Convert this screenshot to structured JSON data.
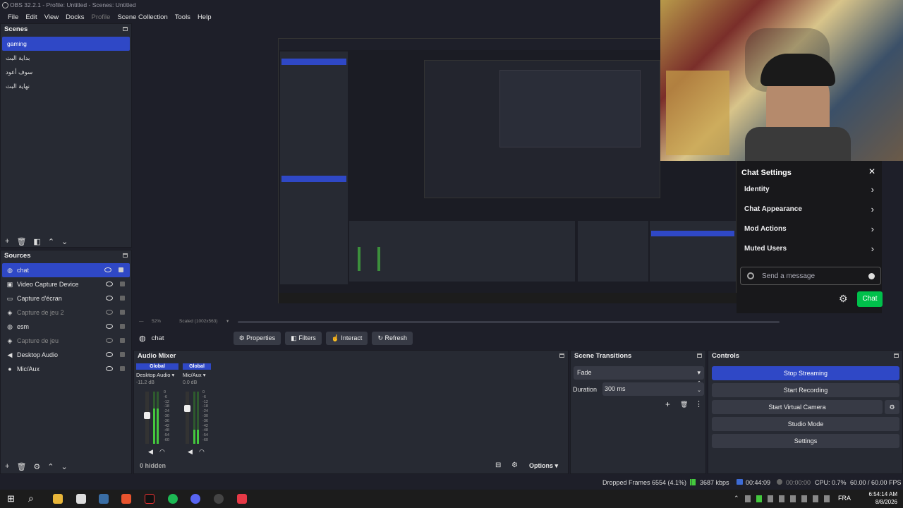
{
  "window": {
    "title": "OBS 32.2.1 - Profile: Untitled - Scenes: Untitled"
  },
  "menu": [
    "File",
    "Edit",
    "View",
    "Docks",
    "Profile",
    "Scene Collection",
    "Tools",
    "Help"
  ],
  "scenes": {
    "title": "Scenes",
    "items": [
      {
        "label": "gaming",
        "selected": true
      },
      {
        "label": "بداية البث",
        "selected": false
      },
      {
        "label": "سوف أعود",
        "selected": false
      },
      {
        "label": "نهاية البث",
        "selected": false
      }
    ]
  },
  "sources": {
    "title": "Sources",
    "items": [
      {
        "label": "chat",
        "icon": "globe-icon",
        "selected": true,
        "visible": true,
        "locked": true
      },
      {
        "label": "Video Capture Device",
        "icon": "camera-icon",
        "selected": false,
        "visible": true,
        "locked": false
      },
      {
        "label": "Capture d'écran",
        "icon": "monitor-icon",
        "selected": false,
        "visible": true,
        "locked": false
      },
      {
        "label": "Capture de jeu 2",
        "icon": "gamepad-icon",
        "selected": false,
        "visible": false,
        "locked": false
      },
      {
        "label": "esm",
        "icon": "globe-icon",
        "selected": false,
        "visible": true,
        "locked": false
      },
      {
        "label": "Capture de jeu",
        "icon": "gamepad-icon",
        "selected": false,
        "visible": false,
        "locked": false
      },
      {
        "label": "Desktop Audio",
        "icon": "speaker-icon",
        "selected": false,
        "visible": true,
        "locked": false
      },
      {
        "label": "Mic/Aux",
        "icon": "mic-icon",
        "selected": false,
        "visible": true,
        "locked": false
      }
    ]
  },
  "preview": {
    "zoom": "52%",
    "scaled": "Scaled (1002x563)"
  },
  "chat_settings": {
    "title": "Chat Settings",
    "items": [
      "Identity",
      "Chat Appearance",
      "Mod Actions",
      "Muted Users"
    ],
    "placeholder": "Send a message",
    "chat_button": "Chat"
  },
  "source_toolbar": {
    "selected": "chat",
    "buttons": [
      "Properties",
      "Filters",
      "Interact",
      "Refresh"
    ]
  },
  "mixer": {
    "title": "Audio Mixer",
    "channels": [
      {
        "badge": "Global",
        "name": "Desktop Audio",
        "db": "-11.2 dB",
        "level": 0.55
      },
      {
        "badge": "Global",
        "name": "Mic/Aux",
        "db": "0.0 dB",
        "level": 0.7
      }
    ],
    "scale": [
      "0",
      "-6",
      "-12",
      "-18",
      "-24",
      "-30",
      "-36",
      "-42",
      "-48",
      "-54",
      "-60"
    ],
    "hidden": "0 hidden",
    "options": "Options"
  },
  "transitions": {
    "title": "Scene Transitions",
    "selected": "Fade",
    "duration_label": "Duration",
    "duration": "300 ms"
  },
  "controls": {
    "title": "Controls",
    "buttons": [
      "Stop Streaming",
      "Start Recording",
      "Start Virtual Camera",
      "Studio Mode",
      "Settings"
    ]
  },
  "status": {
    "dropped": "Dropped Frames 6554 (4.1%)",
    "kbps": "3687 kbps",
    "live_time": "00:44:09",
    "rec_time": "00:00:00",
    "cpu": "CPU: 0.7%",
    "fps": "60.00 / 60.00 FPS"
  },
  "taskbar": {
    "lang": "FRA",
    "time": "6:54:14 AM",
    "date": "8/8/2026"
  },
  "colors": {
    "accent": "#2f48c6",
    "chat_green": "#00c04b"
  }
}
